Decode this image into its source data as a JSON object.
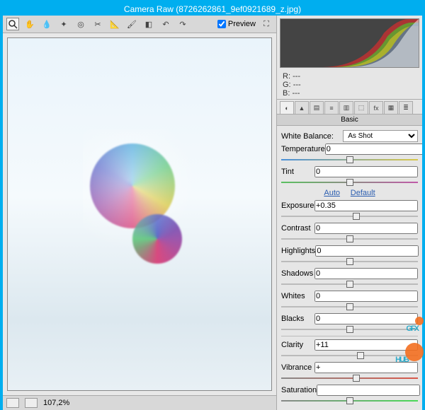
{
  "title": "Camera Raw (8726262861_9ef0921689_z.jpg)",
  "preview_label": "Preview",
  "zoom": "107,2%",
  "rgb": {
    "r_label": "R:",
    "g_label": "G:",
    "b_label": "B:",
    "r": "---",
    "g": "---",
    "b": "---"
  },
  "panel_title": "Basic",
  "wb": {
    "label": "White Balance:",
    "value": "As Shot"
  },
  "auto_label": "Auto",
  "default_label": "Default",
  "sliders": {
    "temperature": {
      "label": "Temperature",
      "value": "0",
      "pos": 50,
      "rail": "temp"
    },
    "tint": {
      "label": "Tint",
      "value": "0",
      "pos": 50,
      "rail": "tint"
    },
    "exposure": {
      "label": "Exposure",
      "value": "+0.35",
      "pos": 55,
      "rail": ""
    },
    "contrast": {
      "label": "Contrast",
      "value": "0",
      "pos": 50,
      "rail": ""
    },
    "highlights": {
      "label": "Highlights",
      "value": "0",
      "pos": 50,
      "rail": ""
    },
    "shadows": {
      "label": "Shadows",
      "value": "0",
      "pos": 50,
      "rail": ""
    },
    "whites": {
      "label": "Whites",
      "value": "0",
      "pos": 50,
      "rail": ""
    },
    "blacks": {
      "label": "Blacks",
      "value": "0",
      "pos": 50,
      "rail": ""
    },
    "clarity": {
      "label": "Clarity",
      "value": "+11",
      "pos": 58,
      "rail": ""
    },
    "vibrance": {
      "label": "Vibrance",
      "value": "+",
      "pos": 55,
      "rail": "vib"
    },
    "saturation": {
      "label": "Saturation",
      "value": "",
      "pos": 50,
      "rail": "sat"
    }
  },
  "watermark": {
    "line1": "GFX",
    "line2": "HUB"
  }
}
